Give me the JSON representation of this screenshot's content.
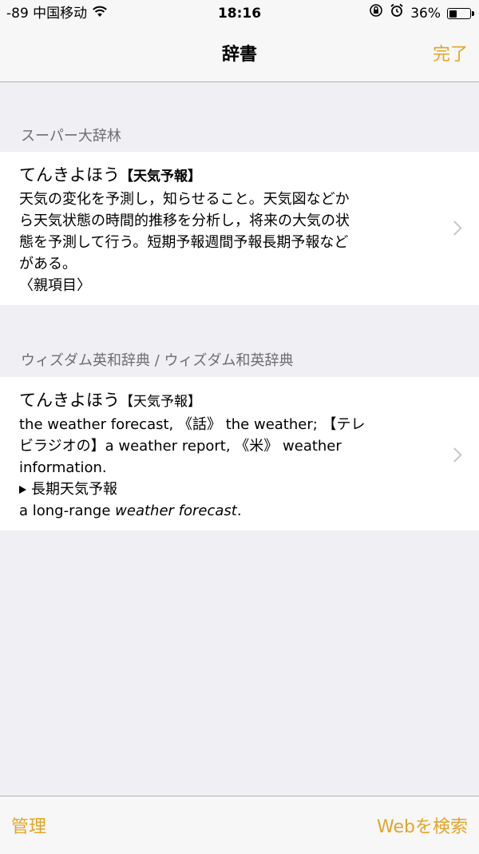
{
  "status_bar": {
    "carrier": "-89 中国移动",
    "time": "18:16",
    "battery_percent": "36%",
    "battery_level": 0.36,
    "icons": [
      "wifi-icon",
      "orientation-lock-icon",
      "alarm-icon",
      "battery-icon"
    ]
  },
  "nav": {
    "title": "辞書",
    "done_label": "完了"
  },
  "sections": [
    {
      "header": "スーパー大辞林",
      "entry": {
        "headword": "てんきよほう",
        "kanji": "【天気予報】",
        "lines": [
          "天気の変化を予測し，知らせること。天気図などか",
          "ら天気状態の時間的推移を分析し，将来の大気の状",
          "態を予測して行う。短期予報週間予報長期予報など",
          "がある。",
          "〈親項目〉"
        ]
      }
    },
    {
      "header": "ウィズダム英和辞典 / ウィズダム和英辞典",
      "entry": {
        "headword": "てんきよほう",
        "kanji": "【天気予報】",
        "lines": [
          "the weather forecast, 《話》 the weather; 【テレ",
          "ビラジオの】a weather report, 《米》 weather",
          "information."
        ],
        "sub_heading": "長期天気予報",
        "example_prefix": "a long-range ",
        "example_italic": "weather forecast",
        "example_suffix": "."
      }
    }
  ],
  "toolbar": {
    "manage_label": "管理",
    "web_search_label": "Webを検索"
  },
  "colors": {
    "accent": "#e2a52a",
    "background": "#efeff4",
    "section_header_text": "#6d6d72",
    "chevron": "#c7c7cc"
  }
}
